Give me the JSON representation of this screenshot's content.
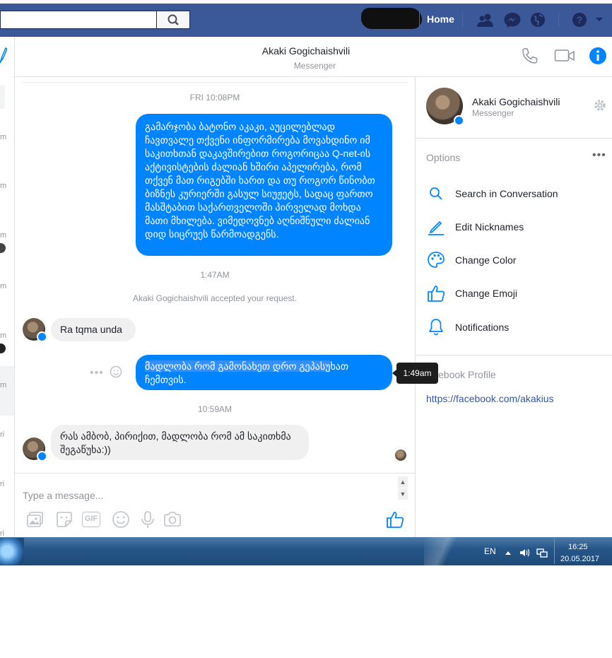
{
  "topbar": {
    "search_placeholder": "",
    "home_label": "Home",
    "icons": [
      "search-icon",
      "friends-icon",
      "messenger-icon",
      "globe-icon",
      "help-icon",
      "caret-down-icon"
    ],
    "bg_color": "#3b5998"
  },
  "left_strip": {
    "fragments": [
      "m",
      "m",
      "m",
      "m",
      "m",
      "m",
      "m",
      "ri",
      "ri",
      "ri"
    ]
  },
  "conversation": {
    "name": "Akaki Gogichaishvili",
    "subtitle": "Messenger",
    "header_icons": [
      "phone-icon",
      "video-camera-icon",
      "info-icon"
    ]
  },
  "messages": {
    "ts1": "FRI 10:08PM",
    "msg1": "გამარჯობა ბატონო აკაკი, აუცილებლად ჩავთვალე თქვენი ინფორმირება მოვახდინო იმ საკითხთან დაკავშირებით როგორიცაა Q-net-ის აქტივისტების ძალიან ხშირი აპელირება, რომ თქვენ მათ რიგებში ხართ და თუ როგორ წინობთ ბიზნეს კურიერში გასულ სიუჟეტს, სადაც ფართო მასშტაბით საქართველოში პირველად მოხდა მათი მხილება. ვიმედოვნებ აღნიშნული ძალიან დიდ სიცრუეს წარმოადგენს.",
    "ts2": "1:47AM",
    "system_note": "Akaki Gogichaishvili accepted your request.",
    "msg2": "Ra tqma unda",
    "msg3_selected": "მადლობა რომ გამონახეთ დრო გეპასუ",
    "msg3_rest": "ხათ ჩემთვის.",
    "tooltip": "1:49am",
    "ts3": "10:59AM",
    "msg4": "რას ამბობ, პირიქით, მადლობა რომ ამ საკითხმა შეგაწუხა:))"
  },
  "composer": {
    "placeholder": "Type a message...",
    "tools": [
      "photo-icon",
      "sticker-icon",
      "gif-icon",
      "emoji-icon",
      "microphone-icon",
      "camera-icon",
      "thumbs-up-icon"
    ],
    "gif_label": "GIF"
  },
  "right_panel": {
    "name": "Akaki Gogichaishvili",
    "subtitle": "Messenger",
    "options_label": "Options",
    "options_more": "•••",
    "options": [
      {
        "label": "Search in Conversation",
        "icon": "search-icon"
      },
      {
        "label": "Edit Nicknames",
        "icon": "pencil-icon"
      },
      {
        "label": "Change Color",
        "icon": "palette-icon"
      },
      {
        "label": "Change Emoji",
        "icon": "thumbs-up-icon"
      },
      {
        "label": "Notifications",
        "icon": "bell-icon"
      }
    ],
    "profile_label": "ebook Profile",
    "profile_link": "https://facebook.com/akakius"
  },
  "taskbar": {
    "lang": "EN",
    "time": "16:25",
    "date": "20.05.2017"
  },
  "colors": {
    "accent": "#0084ff",
    "fb_blue": "#3b5998",
    "link": "#365899"
  }
}
